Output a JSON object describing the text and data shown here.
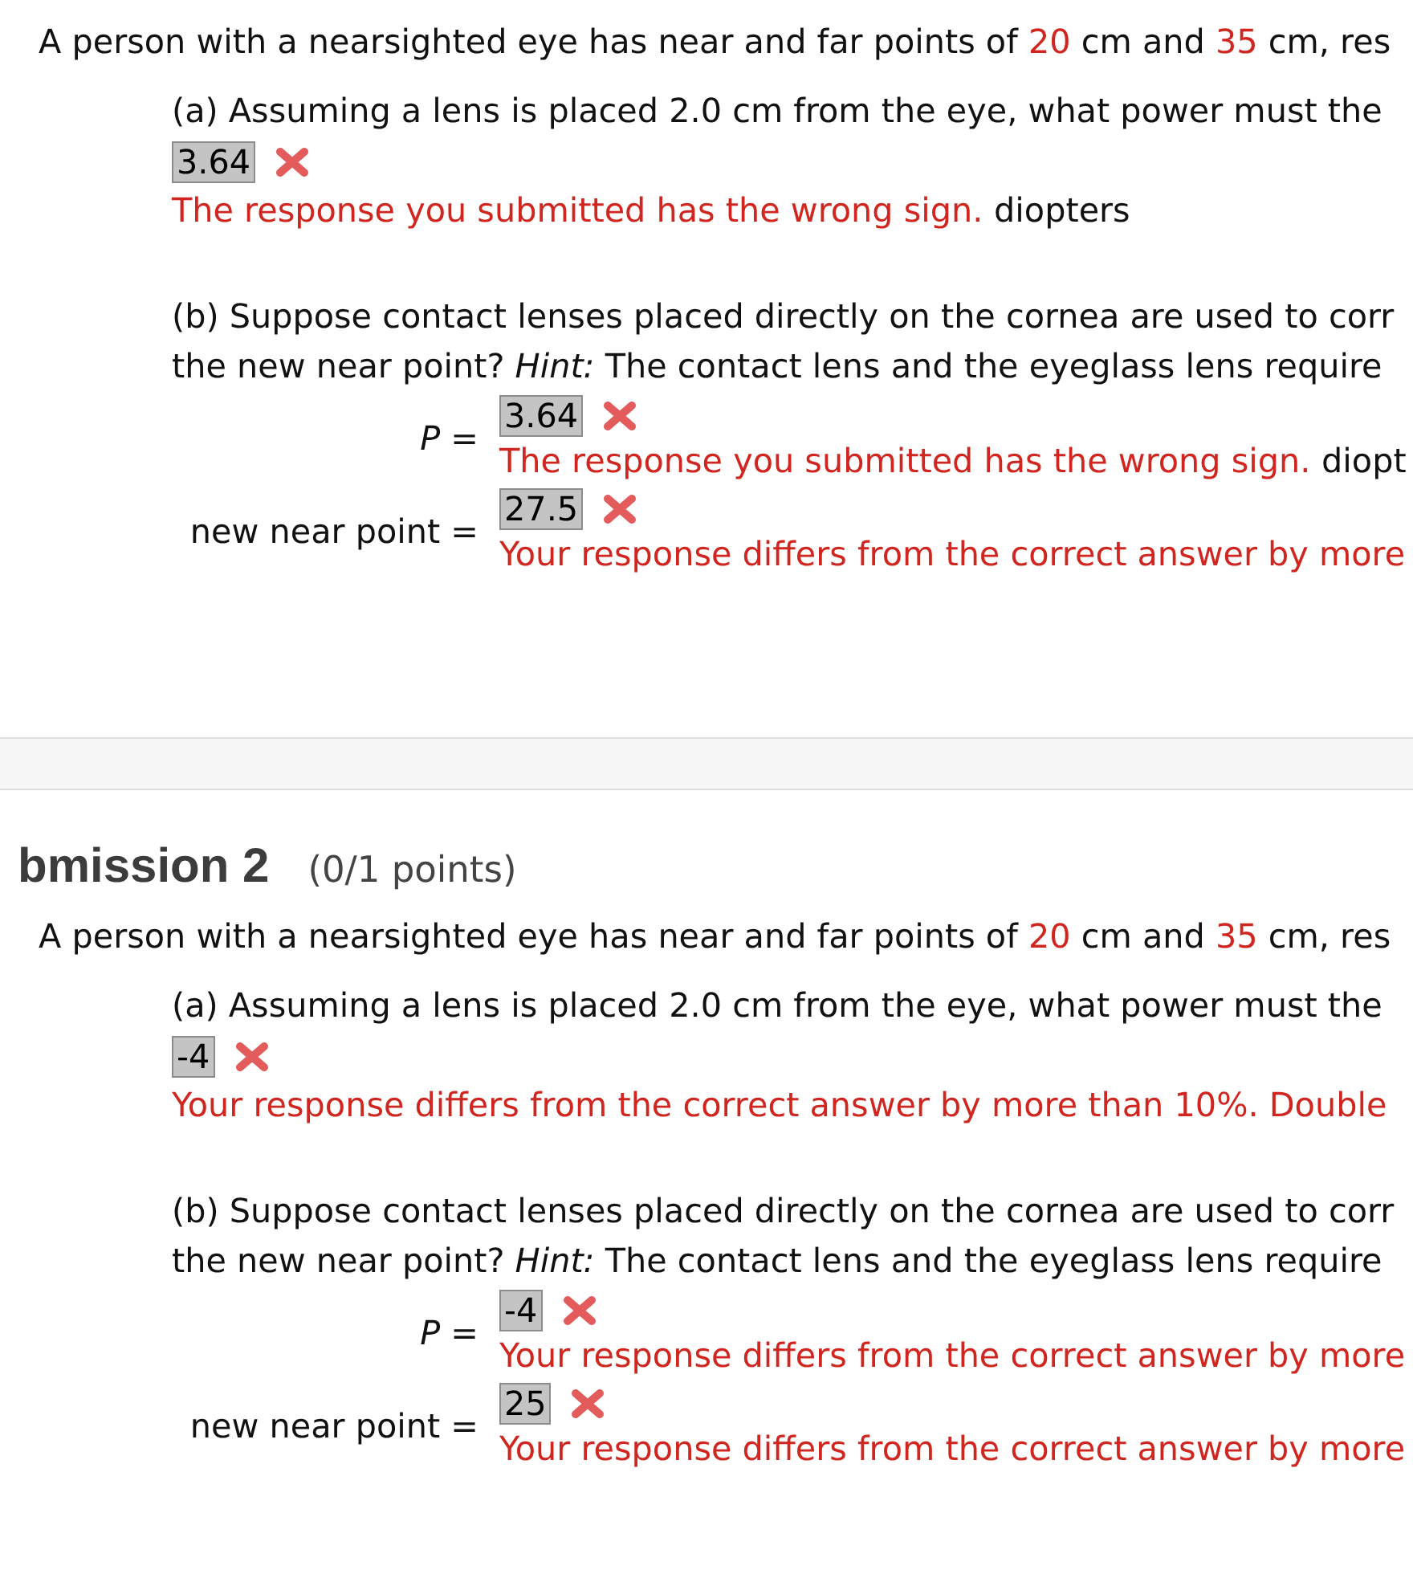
{
  "submissions": [
    {
      "intro": [
        {
          "text": "A person with a nearsighted eye has near and far points of ",
          "kind": "plain"
        },
        {
          "text": "20",
          "kind": "given"
        },
        {
          "text": " cm and ",
          "kind": "plain"
        },
        {
          "text": "35",
          "kind": "given"
        },
        {
          "text": " cm, res",
          "kind": "plain"
        }
      ],
      "parts": [
        {
          "question": [
            "(a) Assuming a lens is placed 2.0 cm from the eye, what power must the"
          ],
          "answers": [
            {
              "value": "3.64",
              "correct": false,
              "feedback": "The response you submitted has the wrong sign.",
              "unit": "diopters"
            }
          ]
        },
        {
          "question": [
            "(b) Suppose contact lenses placed directly on the cornea are used to corr",
            "the new near point? *Hint:* The contact lens and the eyeglass lens require"
          ],
          "answers": [
            {
              "label": "*P* =",
              "value": "3.64",
              "correct": false,
              "feedback": "The response you submitted has the wrong sign.",
              "unit": "diopt"
            },
            {
              "label": "new near point =",
              "value": "27.5",
              "correct": false,
              "feedback": "Your response differs from the correct answer by more"
            }
          ]
        }
      ]
    },
    {
      "heading": "bmission 2",
      "points": "(0/1 points)",
      "intro": [
        {
          "text": "A person with a nearsighted eye has near and far points of ",
          "kind": "plain"
        },
        {
          "text": "20",
          "kind": "given"
        },
        {
          "text": " cm and ",
          "kind": "plain"
        },
        {
          "text": "35",
          "kind": "given"
        },
        {
          "text": " cm, res",
          "kind": "plain"
        }
      ],
      "parts": [
        {
          "question": [
            "(a) Assuming a lens is placed 2.0 cm from the eye, what power must the"
          ],
          "answers": [
            {
              "value": "-4",
              "correct": false,
              "feedback": "Your response differs from the correct answer by more than 10%. Double"
            }
          ]
        },
        {
          "question": [
            "(b) Suppose contact lenses placed directly on the cornea are used to corr",
            "the new near point? *Hint:* The contact lens and the eyeglass lens require"
          ],
          "answers": [
            {
              "label": "*P* =",
              "value": "-4",
              "correct": false,
              "feedback": "Your response differs from the correct answer by more"
            },
            {
              "label": "new near point =",
              "value": "25",
              "correct": false,
              "feedback": "Your response differs from the correct answer by more"
            }
          ]
        }
      ]
    }
  ]
}
